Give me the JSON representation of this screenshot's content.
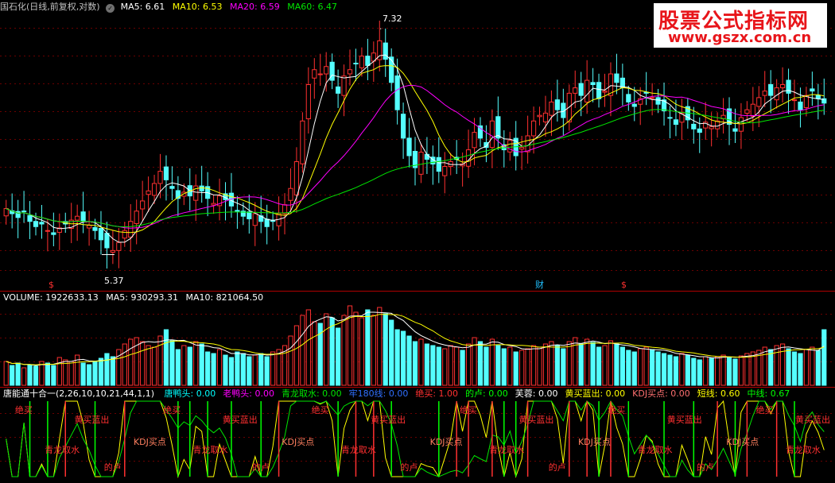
{
  "price_header": {
    "title": "国石化(日线,前复权,对数)",
    "ma5_label": "MA5: 6.61",
    "ma10_label": "MA10: 6.53",
    "ma20_label": "MA20: 6.59",
    "ma60_label": "MA60: 6.47",
    "colors": {
      "title": "#c0c0c0",
      "ma5": "#ffffff",
      "ma10": "#ffff00",
      "ma20": "#ff00ff",
      "ma60": "#00e600"
    }
  },
  "volume_header": {
    "label": "VOLUME: 1922633.13",
    "ma5_label": "MA5: 930293.31",
    "ma10_label": "MA10: 821064.50"
  },
  "indicator_header": {
    "name": "唐能通十合一(2,26,10,10,21,44,1,1)",
    "items": [
      {
        "text": "唐鸭头: 0.00",
        "color": "#00ffff"
      },
      {
        "text": "老鸭头: 0.00",
        "color": "#ff00ff"
      },
      {
        "text": "青龙取水: 0.00",
        "color": "#00e600"
      },
      {
        "text": "牢180线: 0.00",
        "color": "#3070ff"
      },
      {
        "text": "绝买: 1.00",
        "color": "#ff3030"
      },
      {
        "text": "的卢: 0.00",
        "color": "#00ff00"
      },
      {
        "text": "芙蓉: 0.00",
        "color": "#ffffff"
      },
      {
        "text": "黄买蓝出: 0.00",
        "color": "#ffff00"
      },
      {
        "text": "KDJ买点: 0.00",
        "color": "#ff7070"
      },
      {
        "text": "短线: 0.60",
        "color": "#ffff00"
      },
      {
        "text": "中线: 0.67",
        "color": "#00ff00"
      }
    ]
  },
  "annotations": {
    "high": "7.32",
    "low": "5.37",
    "markers": [
      "$",
      "财",
      "$"
    ]
  },
  "signal_labels": [
    "绝买",
    "青龙取水",
    "黄买蓝出",
    "的卢",
    "KDJ买点"
  ],
  "watermark": {
    "line1": "股票公式指标网",
    "line2": "www.gszx.com.cn"
  },
  "chart_data": {
    "type": "candlestick",
    "title": "国石化(日线,前复权,对数)",
    "ylim": [
      5.2,
      7.45
    ],
    "high": 7.32,
    "low": 5.37,
    "close_series": [
      5.72,
      5.68,
      5.65,
      5.7,
      5.62,
      5.58,
      5.6,
      5.55,
      5.52,
      5.57,
      5.6,
      5.63,
      5.66,
      5.62,
      5.59,
      5.55,
      5.48,
      5.42,
      5.4,
      5.46,
      5.55,
      5.62,
      5.7,
      5.78,
      5.86,
      5.92,
      6.02,
      5.95,
      5.88,
      5.8,
      5.85,
      5.82,
      5.9,
      5.86,
      5.8,
      5.76,
      5.82,
      5.79,
      5.74,
      5.7,
      5.66,
      5.64,
      5.68,
      5.62,
      5.58,
      5.62,
      5.68,
      5.75,
      5.88,
      6.1,
      6.45,
      6.78,
      6.92,
      6.88,
      6.95,
      6.82,
      6.7,
      6.86,
      6.92,
      6.98,
      7.05,
      6.96,
      7.08,
      7.2,
      7.02,
      6.8,
      6.55,
      6.3,
      6.15,
      6.05,
      6.18,
      6.12,
      6.08,
      6.02,
      6.06,
      6.1,
      6.12,
      6.08,
      6.2,
      6.35,
      6.3,
      6.22,
      6.45,
      6.3,
      6.2,
      6.28,
      6.15,
      6.22,
      6.32,
      6.45,
      6.5,
      6.52,
      6.62,
      6.55,
      6.48,
      6.7,
      6.75,
      6.68,
      6.82,
      6.78,
      6.65,
      6.72,
      6.88,
      6.8,
      6.75,
      6.62,
      6.58,
      6.65,
      6.7,
      6.66,
      6.6,
      6.54,
      6.48,
      6.42,
      6.52,
      6.46,
      6.38,
      6.35,
      6.44,
      6.4,
      6.45,
      6.5,
      6.42,
      6.36,
      6.48,
      6.55,
      6.6,
      6.66,
      6.72,
      6.68,
      6.75,
      6.78,
      6.7,
      6.64,
      6.55,
      6.68,
      6.72,
      6.65,
      6.61
    ],
    "volume_series": [
      0.3,
      0.25,
      0.28,
      0.22,
      0.26,
      0.24,
      0.3,
      0.28,
      0.25,
      0.35,
      0.32,
      0.3,
      0.38,
      0.28,
      0.26,
      0.3,
      0.34,
      0.4,
      0.36,
      0.45,
      0.52,
      0.58,
      0.6,
      0.55,
      0.5,
      0.48,
      0.62,
      0.7,
      0.56,
      0.45,
      0.5,
      0.48,
      0.55,
      0.52,
      0.42,
      0.4,
      0.45,
      0.38,
      0.35,
      0.42,
      0.4,
      0.36,
      0.38,
      0.4,
      0.36,
      0.42,
      0.45,
      0.5,
      0.62,
      0.75,
      0.88,
      0.95,
      0.8,
      0.78,
      0.9,
      0.85,
      0.72,
      0.88,
      1.0,
      0.92,
      0.85,
      0.95,
      0.88,
      0.98,
      0.9,
      0.82,
      0.7,
      0.68,
      0.62,
      0.55,
      0.58,
      0.52,
      0.5,
      0.48,
      0.46,
      0.5,
      0.48,
      0.44,
      0.52,
      0.6,
      0.55,
      0.48,
      0.58,
      0.5,
      0.46,
      0.48,
      0.42,
      0.44,
      0.46,
      0.5,
      0.48,
      0.52,
      0.55,
      0.5,
      0.46,
      0.55,
      0.6,
      0.52,
      0.58,
      0.54,
      0.48,
      0.5,
      0.56,
      0.52,
      0.48,
      0.44,
      0.42,
      0.46,
      0.48,
      0.45,
      0.42,
      0.4,
      0.38,
      0.36,
      0.4,
      0.38,
      0.34,
      0.32,
      0.36,
      0.34,
      0.36,
      0.38,
      0.35,
      0.33,
      0.37,
      0.4,
      0.42,
      0.44,
      0.48,
      0.45,
      0.5,
      0.52,
      0.46,
      0.42,
      0.4,
      0.45,
      0.48,
      0.44,
      0.7
    ]
  }
}
